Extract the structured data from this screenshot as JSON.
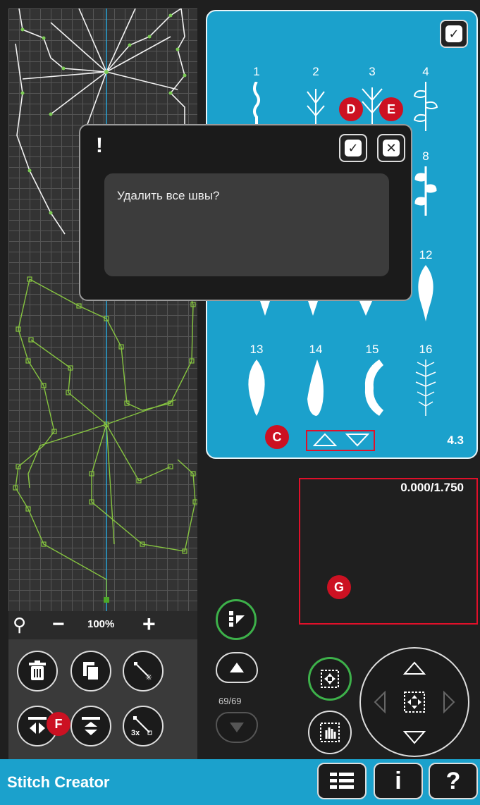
{
  "app": {
    "title": "Stitch Creator"
  },
  "zoom": {
    "value": "100%"
  },
  "stitch_panel": {
    "page_indicator": "4.3",
    "stitches": [
      {
        "number": "1"
      },
      {
        "number": "2"
      },
      {
        "number": "3"
      },
      {
        "number": "4"
      },
      {
        "number": "8"
      },
      {
        "number": "12"
      },
      {
        "number": "13"
      },
      {
        "number": "14"
      },
      {
        "number": "15"
      },
      {
        "number": "16"
      }
    ]
  },
  "popup": {
    "icon": "!",
    "message": "Удалить все швы?"
  },
  "callouts": {
    "c": "C",
    "d": "D",
    "e": "E",
    "f": "F",
    "g": "G"
  },
  "counter": {
    "value": "69/69"
  },
  "position": {
    "readout": "0.000/1.750"
  },
  "colors": {
    "accent": "#1ba1cc",
    "highlight": "#e0102a",
    "selected": "#3db14a"
  }
}
